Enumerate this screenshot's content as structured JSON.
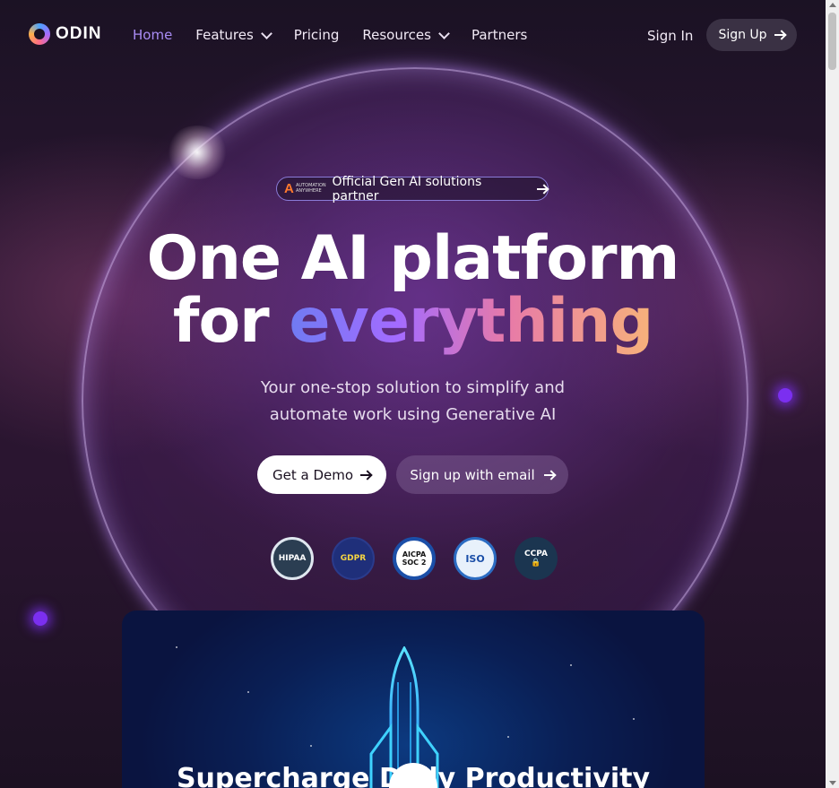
{
  "nav": {
    "logo_text": "ODIN",
    "links": [
      {
        "label": "Home",
        "active": true
      },
      {
        "label": "Features",
        "dropdown": true
      },
      {
        "label": "Pricing"
      },
      {
        "label": "Resources",
        "dropdown": true
      },
      {
        "label": "Partners"
      }
    ],
    "sign_in": "Sign In",
    "sign_up": "Sign Up"
  },
  "hero": {
    "badge_logo_text": "AUTOMATION ANYWHERE",
    "badge_text": "Official Gen AI solutions partner",
    "headline_line1": "One AI platform",
    "headline_line2_prefix": "for",
    "headline_line2_highlight": "everything",
    "subtitle_line1": "Your one-stop solution to simplify and",
    "subtitle_line2": "automate work using Generative AI",
    "demo_button": "Get a Demo",
    "email_button": "Sign up with email"
  },
  "certifications": [
    {
      "name": "HIPAA",
      "label": "HIPAA"
    },
    {
      "name": "GDPR",
      "label": "GDPR"
    },
    {
      "name": "SOC 2",
      "label_top": "AICPA",
      "label": "SOC 2"
    },
    {
      "name": "ISO",
      "label": "ISO"
    },
    {
      "name": "CCPA",
      "label": "CCPA"
    }
  ],
  "video": {
    "title": "Supercharge Daily Productivity"
  },
  "colors": {
    "accent": "#a98cf5",
    "gradient_start": "#6f7bf2",
    "gradient_end": "#f7b27a"
  }
}
